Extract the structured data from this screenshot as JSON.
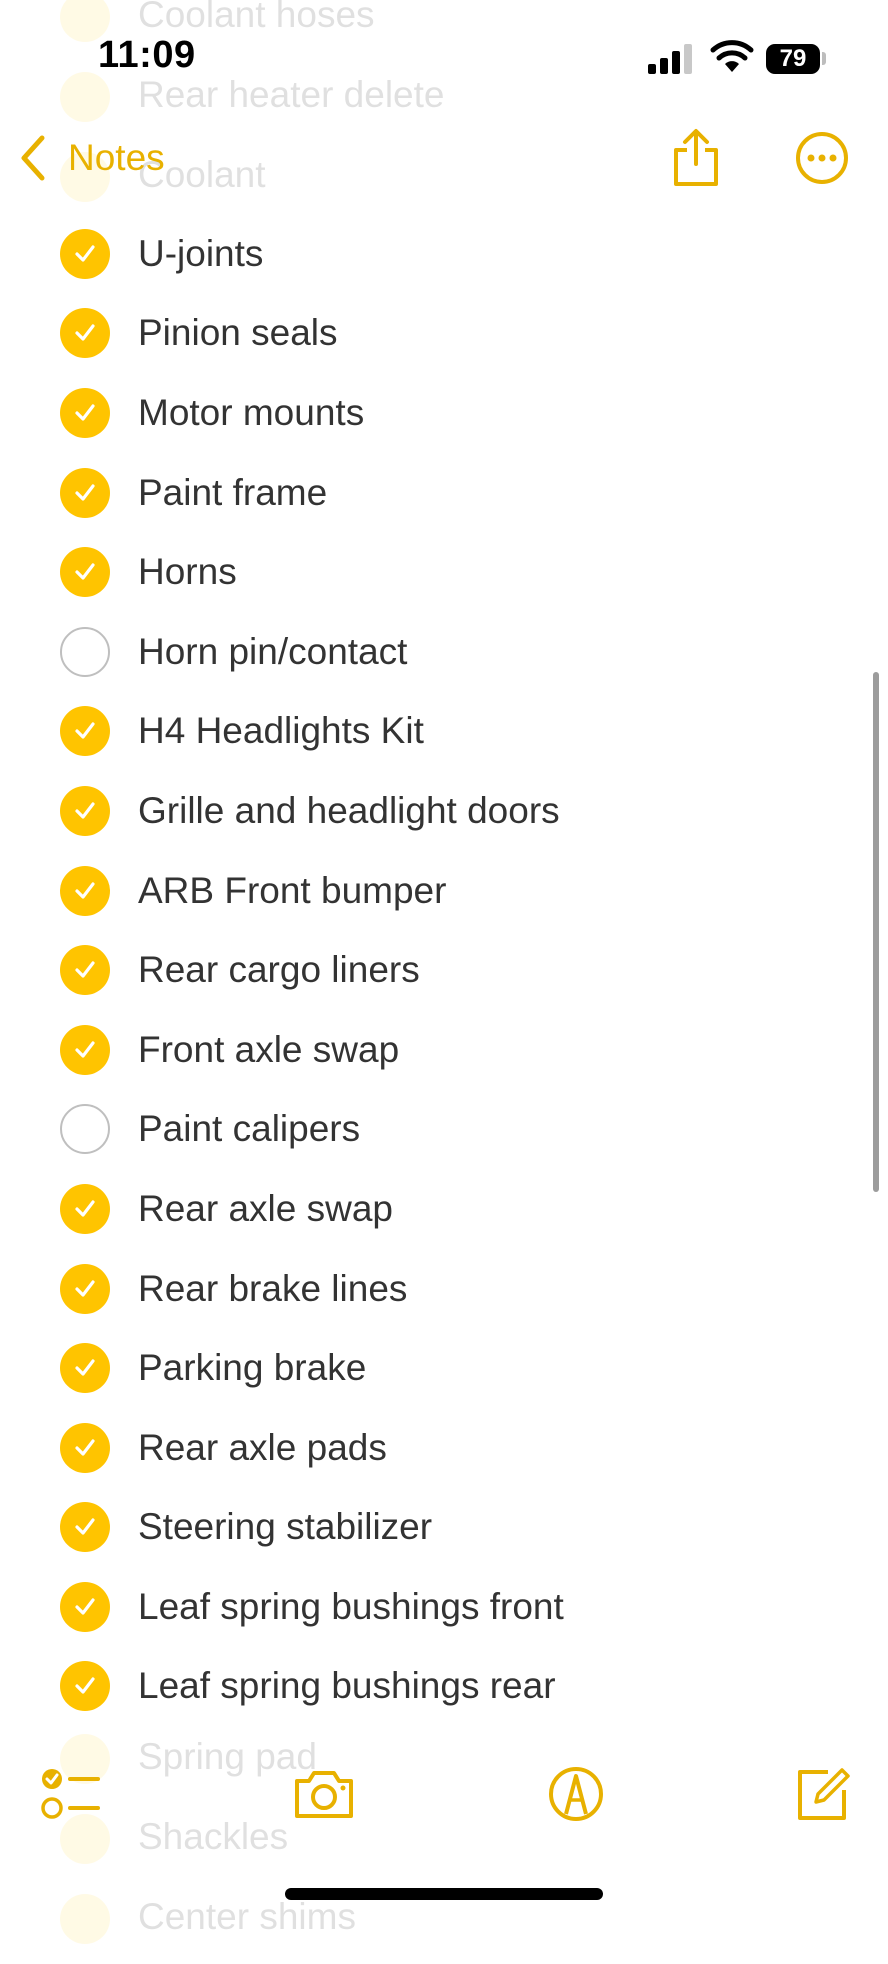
{
  "status_bar": {
    "time": "11:09",
    "battery": "79"
  },
  "nav": {
    "back_label": "Notes",
    "back_icon": "chevron-left-icon",
    "share_icon": "share-icon",
    "more_icon": "ellipsis-circle-icon"
  },
  "faded_above": [
    "Coolant hoses",
    "Rear heater delete",
    "Coolant"
  ],
  "faded_below": [
    "Spring pad",
    "Shackles",
    "Center shims"
  ],
  "checklist": [
    {
      "label": "U-joints",
      "checked": true
    },
    {
      "label": "Pinion seals",
      "checked": true
    },
    {
      "label": "Motor mounts",
      "checked": true
    },
    {
      "label": "Paint frame",
      "checked": true
    },
    {
      "label": "Horns",
      "checked": true
    },
    {
      "label": "Horn pin/contact",
      "checked": false
    },
    {
      "label": "H4 Headlights Kit",
      "checked": true
    },
    {
      "label": "Grille and headlight doors",
      "checked": true
    },
    {
      "label": "ARB Front bumper",
      "checked": true
    },
    {
      "label": "Rear cargo liners",
      "checked": true
    },
    {
      "label": "Front axle swap",
      "checked": true
    },
    {
      "label": "Paint calipers",
      "checked": false
    },
    {
      "label": "Rear axle swap",
      "checked": true
    },
    {
      "label": "Rear brake lines",
      "checked": true
    },
    {
      "label": "Parking brake",
      "checked": true
    },
    {
      "label": "Rear axle pads",
      "checked": true
    },
    {
      "label": "Steering stabilizer",
      "checked": true
    },
    {
      "label": "Leaf spring bushings front",
      "checked": true
    },
    {
      "label": "Leaf spring bushings rear",
      "checked": true
    }
  ],
  "toolbar": {
    "checklist_icon": "checklist-icon",
    "camera_icon": "camera-icon",
    "markup_icon": "markup-pen-icon",
    "compose_icon": "compose-icon"
  },
  "colors": {
    "accent": "#e8b100",
    "check_fill": "#ffc400"
  }
}
